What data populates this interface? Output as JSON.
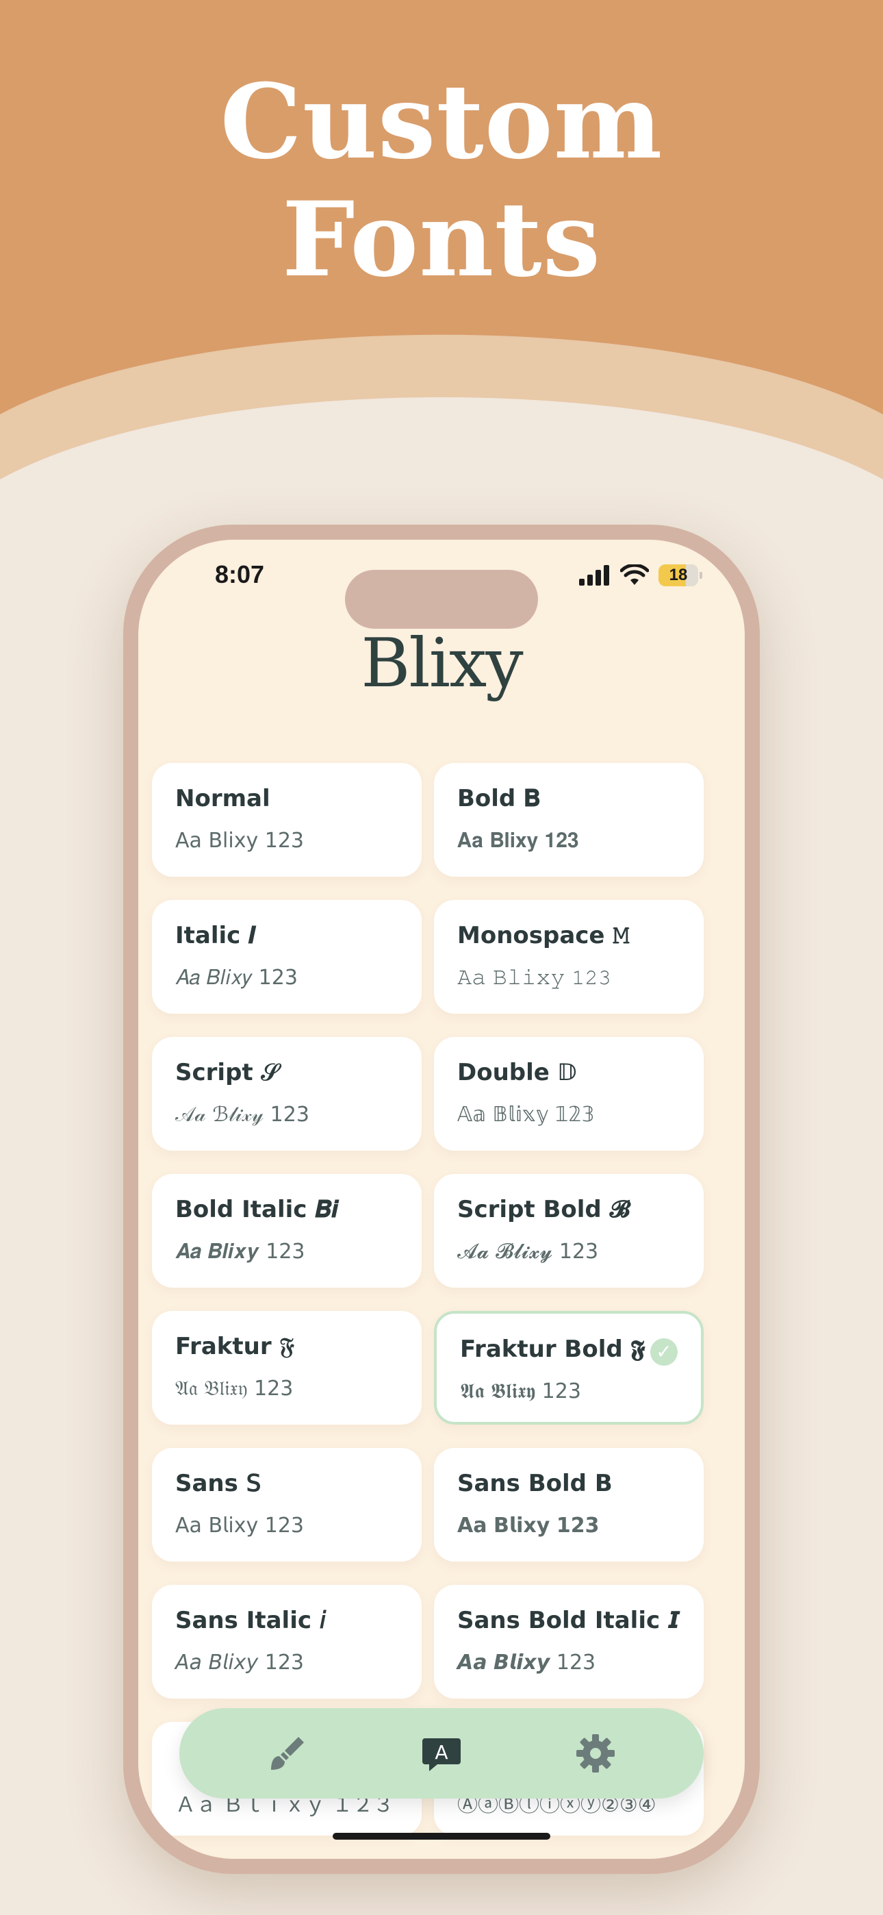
{
  "hero": {
    "title": "Custom\nFonts"
  },
  "status_bar": {
    "time": "8:07",
    "battery": "18"
  },
  "app": {
    "title": "Blixy"
  },
  "fonts": [
    {
      "name": "Normal",
      "sample": "Aa Blixy 123"
    },
    {
      "name": "Bold 𝐁",
      "sample": "𝐀𝐚 𝐁𝐥𝐢𝐱𝐲 𝟏𝟐𝟑"
    },
    {
      "name": "Italic 𝑰",
      "sample": "𝐴𝑎 𝐵𝑙𝑖𝑥𝑦 123"
    },
    {
      "name": "Monospace 𝙼",
      "sample": "𝙰𝚊 𝙱𝚕𝚒𝚡𝚢 𝟷𝟸𝟹"
    },
    {
      "name": "Script 𝒮",
      "sample": "𝒜𝒶 ℬ𝓁𝒾𝓍𝓎 123"
    },
    {
      "name": "Double 𝔻",
      "sample": "𝔸𝕒 𝔹𝕝𝕚𝕩𝕪 𝟙𝟚𝟛"
    },
    {
      "name": "Bold Italic 𝑩𝒊",
      "sample": "𝑨𝒂 𝑩𝒍𝒊𝒙𝒚 123"
    },
    {
      "name": "Script Bold 𝓑",
      "sample": "𝓐𝓪 𝓑𝓵𝓲𝔁𝔂 123"
    },
    {
      "name": "Fraktur 𝔉",
      "sample": "𝔄𝔞 𝔅𝔩𝔦𝔵𝔶 123"
    },
    {
      "name": "Fraktur Bold 𝕱",
      "sample": "𝕬𝖆 𝕭𝖑𝖎𝖝𝖞 123"
    },
    {
      "name": "Sans 𝖲",
      "sample": "𝖠𝖺 𝖡𝗅𝗂𝗑𝗒 𝟣𝟤𝟥"
    },
    {
      "name": "Sans Bold 𝗕",
      "sample": "𝗔𝗮 𝗕𝗹𝗶𝘅𝘆 𝟭𝟮𝟯"
    },
    {
      "name": "Sans Italic 𝘪",
      "sample": "𝘈𝘢 𝘉𝘭𝘪𝘹𝘺 123"
    },
    {
      "name": "Sans Bold Italic 𝙄",
      "sample": "𝘼𝙖 𝘽𝙡𝙞𝙭𝙮 123"
    },
    {
      "name": "",
      "sample": "Ａａ Ｂｌｉｘｙ １２３"
    },
    {
      "name": "",
      "sample": "ⒶⓐⒷⓛⓘⓧⓨ②③④"
    }
  ],
  "selected_index": 9,
  "tabbar": {
    "items": [
      "brush-icon",
      "font-chat-icon",
      "gear-icon"
    ],
    "font_tab_letter": "A"
  },
  "colors": {
    "hero_bg": "#d99d6a",
    "hero_wave": "#e8c9a8",
    "page_bg": "#f1e8de",
    "phone_frame": "#d3b3a3",
    "screen_bg": "#fcf0df",
    "accent_green": "#c6e4c8",
    "text_dark": "#2d3a3c"
  }
}
